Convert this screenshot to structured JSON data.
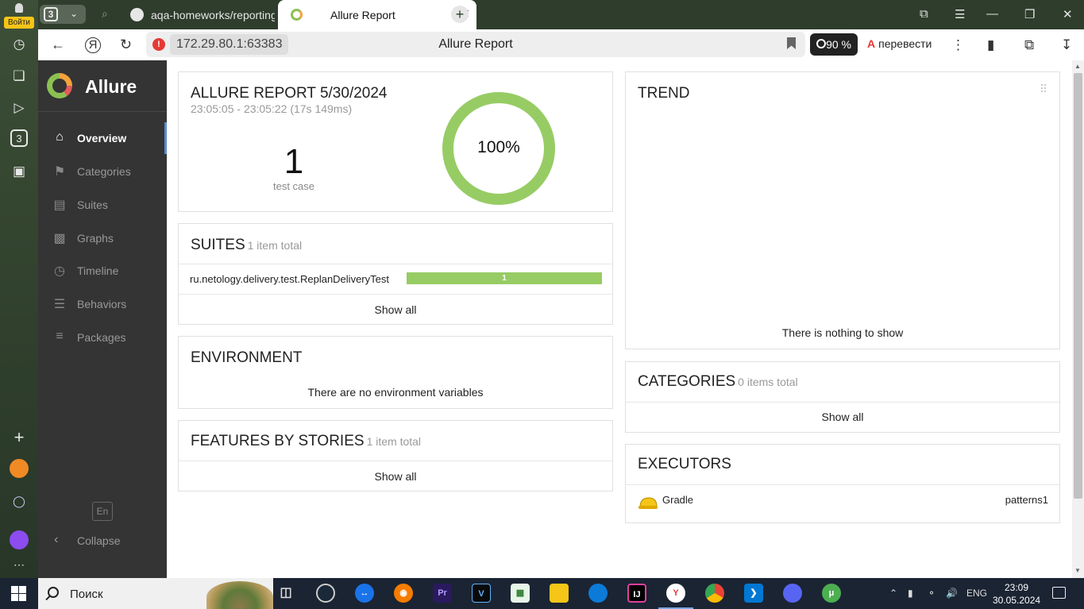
{
  "browser": {
    "login_label": "Войти",
    "tab_count": "3",
    "rail_badge": "3",
    "tabs": [
      {
        "title": "aqa-homeworks/reporting"
      },
      {
        "title": "Allure Report"
      }
    ],
    "url_host": "172.29.80.1:63383",
    "page_title": "Allure Report",
    "zoom": "90 %",
    "translate_label": "перевести",
    "nav_glyph": "Я"
  },
  "sidebar": {
    "brand": "Allure",
    "items": [
      {
        "label": "Overview",
        "icon": "home-icon",
        "active": true
      },
      {
        "label": "Categories",
        "icon": "flag-icon"
      },
      {
        "label": "Suites",
        "icon": "briefcase-icon"
      },
      {
        "label": "Graphs",
        "icon": "bar-chart-icon"
      },
      {
        "label": "Timeline",
        "icon": "clock-icon"
      },
      {
        "label": "Behaviors",
        "icon": "list-icon"
      },
      {
        "label": "Packages",
        "icon": "align-left-icon"
      }
    ],
    "lang": "En",
    "collapse_label": "Collapse"
  },
  "summary": {
    "title": "ALLURE REPORT 5/30/2024",
    "time_range": "23:05:05 - 23:05:22 (17s 149ms)",
    "test_count": "1",
    "test_count_label": "test case",
    "pass_rate": 1.0,
    "pass_rate_label": "100%",
    "pass_color": "#97cc64"
  },
  "suites": {
    "title": "SUITES",
    "subtitle": "1 item total",
    "rows": [
      {
        "name": "ru.netology.delivery.test.ReplanDeliveryTest",
        "passed": "1"
      }
    ],
    "show_all": "Show all"
  },
  "environment": {
    "title": "ENVIRONMENT",
    "empty": "There are no environment variables"
  },
  "features": {
    "title": "FEATURES BY STORIES",
    "subtitle": "1 item total",
    "show_all": "Show all"
  },
  "trend": {
    "title": "TREND",
    "empty": "There is nothing to show"
  },
  "categories": {
    "title": "CATEGORIES",
    "subtitle": "0 items total",
    "show_all": "Show all"
  },
  "executors": {
    "title": "EXECUTORS",
    "rows": [
      {
        "name": "Gradle",
        "build": "patterns1",
        "icon": "hard-hat-icon"
      }
    ]
  },
  "taskbar": {
    "search_placeholder": "Поиск",
    "lang": "ENG",
    "time": "23:09",
    "date": "30.05.2024"
  }
}
